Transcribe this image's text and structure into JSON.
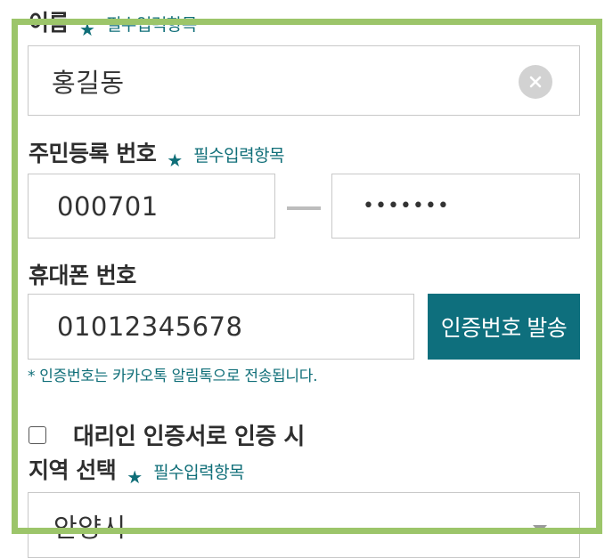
{
  "name": {
    "label": "이름",
    "required_mark": "★",
    "required_text": "필수입력항목",
    "value": "홍길동",
    "clear_icon": "close-circle-icon"
  },
  "rrn": {
    "label": "주민등록 번호",
    "required_mark": "★",
    "required_text": "필수입력항목",
    "front": "000701",
    "back_masked": "•••••••"
  },
  "phone": {
    "label": "휴대폰 번호",
    "value": "01012345678",
    "send_button": "인증번호 발송",
    "note": "* 인증번호는 카카오톡 알림톡으로 전송됩니다."
  },
  "proxy": {
    "label": "대리인 인증서로 인증 시",
    "checked": false
  },
  "region": {
    "label": "지역 선택",
    "required_mark": "★",
    "required_text": "필수입력항목",
    "selected": "안양시",
    "arrow_icon": "chevron-down-icon"
  },
  "colors": {
    "accent": "#0e6f7d",
    "frame": "#9cc56a"
  }
}
